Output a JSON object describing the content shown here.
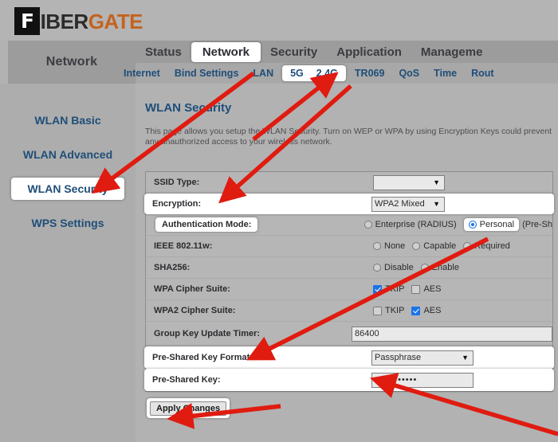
{
  "brand": {
    "logo_f": "F",
    "logo_part1": "IBER",
    "logo_part2": "GATE"
  },
  "nav": {
    "panel_label": "Network",
    "tabs": [
      {
        "label": "Status",
        "selected": false
      },
      {
        "label": "Network",
        "selected": true
      },
      {
        "label": "Security",
        "selected": false
      },
      {
        "label": "Application",
        "selected": false
      },
      {
        "label": "Manageme",
        "selected": false
      }
    ],
    "subtabs": [
      {
        "label": "Internet",
        "selected": false
      },
      {
        "label": "Bind Settings",
        "selected": false
      },
      {
        "label": "LAN",
        "selected": false
      },
      {
        "label": "5G",
        "selected": true
      },
      {
        "label": "2.4G",
        "selected": true
      },
      {
        "label": "TR069",
        "selected": false
      },
      {
        "label": "QoS",
        "selected": false
      },
      {
        "label": "Time",
        "selected": false
      },
      {
        "label": "Rout",
        "selected": false
      }
    ]
  },
  "sidebar": {
    "items": [
      {
        "label": "WLAN Basic",
        "selected": false
      },
      {
        "label": "WLAN Advanced",
        "selected": false
      },
      {
        "label": "WLAN Security",
        "selected": true
      },
      {
        "label": "WPS Settings",
        "selected": false
      }
    ]
  },
  "content": {
    "title": "WLAN Security",
    "description": "This page allows you setup the WLAN Security. Turn on WEP or WPA by using Encryption Keys could prevent any unauthorized access to your wireless network."
  },
  "form": {
    "ssid_type": {
      "label": "SSID Type:",
      "value": "",
      "blurred": true
    },
    "encryption": {
      "label": "Encryption:",
      "value": "WPA2 Mixed"
    },
    "authentication_mode": {
      "label": "Authentication Mode:",
      "options": [
        {
          "label": "Enterprise (RADIUS)",
          "selected": false
        },
        {
          "label": "Personal",
          "selected": true
        },
        {
          "label": "(Pre-Sh",
          "selected": null
        }
      ]
    },
    "ieee_80211w": {
      "label": "IEEE 802.11w:",
      "options": [
        {
          "label": "None",
          "selected": false
        },
        {
          "label": "Capable",
          "selected": false
        },
        {
          "label": "Required",
          "selected": false
        }
      ]
    },
    "sha256": {
      "label": "SHA256:",
      "options": [
        {
          "label": "Disable",
          "selected": false
        },
        {
          "label": "Enable",
          "selected": false
        }
      ]
    },
    "wpa_cipher_suite": {
      "label": "WPA Cipher Suite:",
      "options": [
        {
          "label": "TKIP",
          "checked": true
        },
        {
          "label": "AES",
          "checked": false
        }
      ]
    },
    "wpa2_cipher_suite": {
      "label": "WPA2 Cipher Suite:",
      "options": [
        {
          "label": "TKIP",
          "checked": false
        },
        {
          "label": "AES",
          "checked": true
        }
      ]
    },
    "group_key_update_timer": {
      "label": "Group Key Update Timer:",
      "value": "86400"
    },
    "psk_format": {
      "label": "Pre-Shared Key Format:",
      "value": "Passphrase"
    },
    "psk": {
      "label": "Pre-Shared Key:",
      "value": "•••••••••••"
    }
  },
  "actions": {
    "apply_label": "Apply Changes"
  },
  "annotation": {
    "arrow_color": "#e01b10",
    "arrow_count": 6
  }
}
